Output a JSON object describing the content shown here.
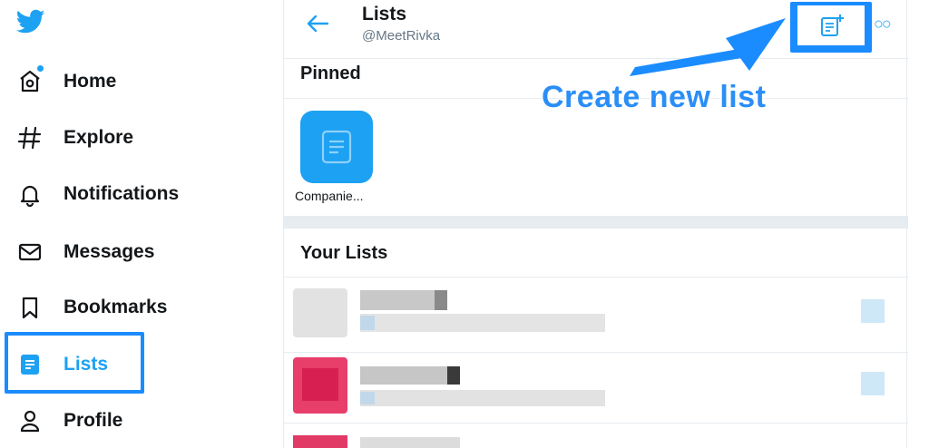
{
  "sidebar": {
    "items": [
      {
        "label": "Home",
        "icon": "home-icon"
      },
      {
        "label": "Explore",
        "icon": "hashtag-icon"
      },
      {
        "label": "Notifications",
        "icon": "bell-icon"
      },
      {
        "label": "Messages",
        "icon": "envelope-icon"
      },
      {
        "label": "Bookmarks",
        "icon": "bookmark-icon"
      },
      {
        "label": "Lists",
        "icon": "lists-icon"
      },
      {
        "label": "Profile",
        "icon": "person-icon"
      }
    ]
  },
  "header": {
    "title": "Lists",
    "handle": "@MeetRivka"
  },
  "pinned": {
    "title": "Pinned",
    "items": [
      {
        "label": "Companie..."
      }
    ]
  },
  "your_lists": {
    "title": "Your Lists"
  },
  "annotation": {
    "text": "Create new list"
  },
  "colors": {
    "accent": "#1da1f2",
    "highlight": "#1a8cff",
    "text": "#14171a",
    "muted": "#657786"
  }
}
